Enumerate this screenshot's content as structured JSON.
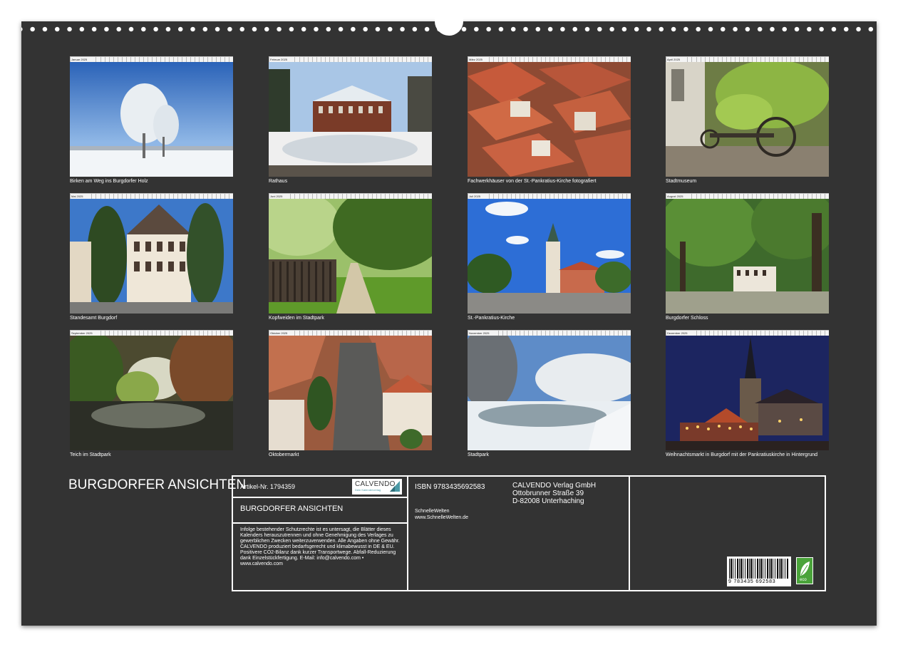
{
  "calendar": {
    "title": "BURGDORFER ANSICHTEN",
    "months": [
      {
        "name": "Januar 2025",
        "caption": "Birken am Weg ins Burgdorfer Holz"
      },
      {
        "name": "Februar 2025",
        "caption": "Rathaus"
      },
      {
        "name": "März 2025",
        "caption": "Fachwerkhäuser von der St.-Pankratius-Kirche fotografiert"
      },
      {
        "name": "April 2025",
        "caption": "Stadtmuseum"
      },
      {
        "name": "Mai 2025",
        "caption": "Standesamt Burgdorf"
      },
      {
        "name": "Juni 2025",
        "caption": "Kopfweiden im Stadtpark"
      },
      {
        "name": "Juli 2025",
        "caption": "St.-Pankratius-Kirche"
      },
      {
        "name": "August 2025",
        "caption": "Burgdorfer Schloss"
      },
      {
        "name": "September 2025",
        "caption": "Teich im Stadtpark"
      },
      {
        "name": "Oktober 2025",
        "caption": "Oktobermarkt"
      },
      {
        "name": "November 2025",
        "caption": "Stadtpark"
      },
      {
        "name": "Dezember 2025",
        "caption": "Weihnachtsmarkt in Burgdorf mit der Pankratiuskirche in Hintergrund"
      }
    ]
  },
  "info": {
    "article": "Artikel-Nr. 1794359",
    "product_title": "BURGDORFER ANSICHTEN",
    "legal_text": "Infolge bestehender Schutzrechte ist es untersagt, die Blätter dieses Kalenders herauszutrennen und ohne Genehmigung des Verlages zu gewerblichen Zwecken weiterzuverwenden. Alle Angaben ohne Gewähr. CALVENDO produziert bedarfsgerecht und klimabewusst in DE & EU. Positivere CO2-Bilanz dank kurzer Transportwege. Abfall-Reduzierung dank Einzelstückfertigung. E-Mail: info@calvendo.com • www.calvendo.com",
    "isbn": "ISBN 9783435692583",
    "author_line1": "SchnelleWelten",
    "author_line2": "www.SchnelleWelten.de",
    "publisher_line1": "CALVENDO Verlag GmbH",
    "publisher_line2": "Ottobrunner Straße 39",
    "publisher_line3": "D-82008 Unterhaching",
    "logo_name": "CALVENDO",
    "logo_slogan": "Dein Kalenderverlag",
    "barcode_number": "9 783435 692583",
    "eco_label": "eco",
    "logo_color": "#4c9aa6",
    "eco_color": "#4aa33a"
  }
}
